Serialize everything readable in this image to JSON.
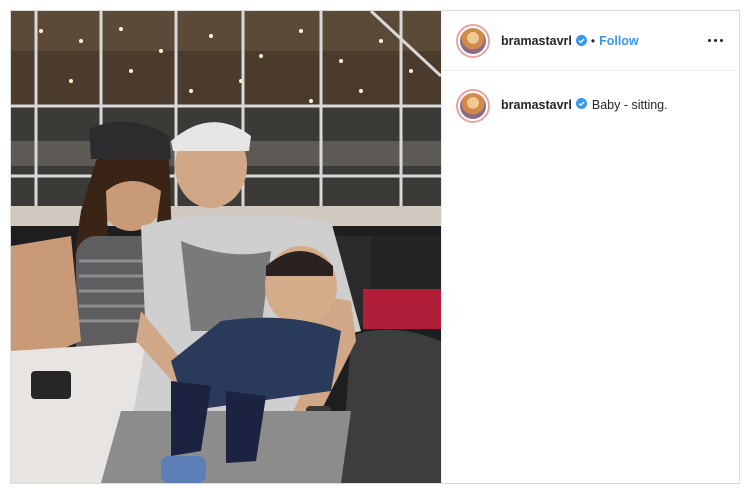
{
  "post": {
    "username": "bramastavrl",
    "follow_label": "Follow",
    "separator": "•",
    "caption": "Baby - sitting."
  },
  "icons": {
    "verified": "verified-badge-icon",
    "more": "more-options-icon"
  },
  "colors": {
    "link": "#3897f0",
    "verified": "#3897f0",
    "text": "#262626",
    "border": "#dbdbdb"
  }
}
